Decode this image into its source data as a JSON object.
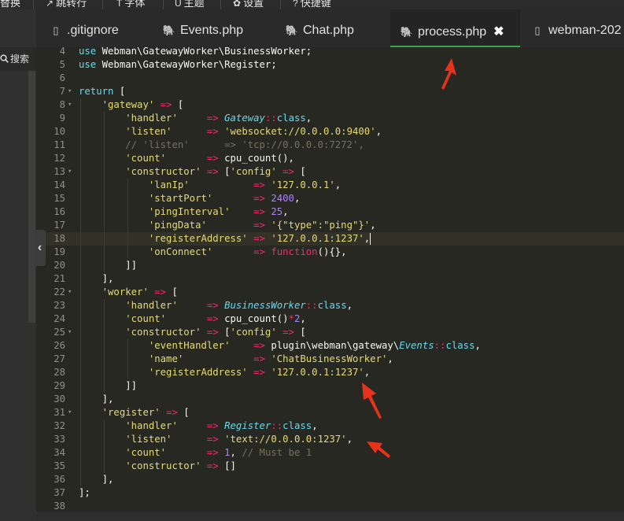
{
  "menubar": {
    "items": [
      {
        "icon": "",
        "label": "替换"
      },
      {
        "icon": "↗",
        "label": "跳转行"
      },
      {
        "icon": "T",
        "label": "字体"
      },
      {
        "icon": "U",
        "label": "主题"
      },
      {
        "icon": "✿",
        "label": "设置"
      },
      {
        "icon": "?",
        "label": "快捷键"
      }
    ]
  },
  "sidebar": {
    "search_label": "搜索",
    "search_icon": "magnifier-icon",
    "collapse_glyph": "‹"
  },
  "tabs": [
    {
      "label": ".gitignore",
      "icon": "file-icon",
      "glyph": "▯"
    },
    {
      "label": "Events.php",
      "icon": "php-elephant-icon",
      "glyph": "🐘"
    },
    {
      "label": "Chat.php",
      "icon": "php-elephant-icon",
      "glyph": "🐘"
    },
    {
      "label": "process.php",
      "icon": "php-elephant-icon",
      "glyph": "🐘",
      "active": true,
      "close": "✖"
    },
    {
      "label": "webman-202",
      "icon": "file-icon",
      "glyph": "▯"
    }
  ],
  "editor": {
    "current_line": 18,
    "lines": [
      {
        "n": "4",
        "fold": "",
        "tokens": [
          [
            "kw",
            "use"
          ],
          [
            "pl",
            " Webman\\GatewayWorker\\BusinessWorker;"
          ]
        ]
      },
      {
        "n": "5",
        "fold": "",
        "tokens": [
          [
            "kw",
            "use"
          ],
          [
            "pl",
            " Webman\\GatewayWorker\\Register;"
          ]
        ]
      },
      {
        "n": "6",
        "fold": "",
        "tokens": []
      },
      {
        "n": "7",
        "fold": "▾",
        "tokens": [
          [
            "kw",
            "return"
          ],
          [
            "pl",
            " ["
          ]
        ]
      },
      {
        "n": "8",
        "fold": "▾",
        "tokens": [
          [
            "pl",
            "    "
          ],
          [
            "str",
            "'gateway'"
          ],
          [
            "pl",
            " "
          ],
          [
            "op",
            "=>"
          ],
          [
            "pl",
            " ["
          ]
        ]
      },
      {
        "n": "9",
        "fold": "",
        "tokens": [
          [
            "pl",
            "        "
          ],
          [
            "str",
            "'handler'"
          ],
          [
            "pl",
            "     "
          ],
          [
            "op",
            "=>"
          ],
          [
            "pl",
            " "
          ],
          [
            "cls",
            "Gateway"
          ],
          [
            "op",
            "::"
          ],
          [
            "kw",
            "class"
          ],
          [
            "pl",
            ","
          ]
        ]
      },
      {
        "n": "10",
        "fold": "",
        "tokens": [
          [
            "pl",
            "        "
          ],
          [
            "str",
            "'listen'"
          ],
          [
            "pl",
            "      "
          ],
          [
            "op",
            "=>"
          ],
          [
            "pl",
            " "
          ],
          [
            "str",
            "'websocket://0.0.0.0:9400'"
          ],
          [
            "pl",
            ","
          ]
        ]
      },
      {
        "n": "11",
        "fold": "",
        "tokens": [
          [
            "pl",
            "        "
          ],
          [
            "cm",
            "// 'listen'      => 'tcp://0.0.0.0:7272',"
          ]
        ]
      },
      {
        "n": "12",
        "fold": "",
        "tokens": [
          [
            "pl",
            "        "
          ],
          [
            "str",
            "'count'"
          ],
          [
            "pl",
            "       "
          ],
          [
            "op",
            "=>"
          ],
          [
            "pl",
            " cpu_count(),"
          ]
        ]
      },
      {
        "n": "13",
        "fold": "▾",
        "tokens": [
          [
            "pl",
            "        "
          ],
          [
            "str",
            "'constructor'"
          ],
          [
            "pl",
            " "
          ],
          [
            "op",
            "=>"
          ],
          [
            "pl",
            " ["
          ],
          [
            "str",
            "'config'"
          ],
          [
            "pl",
            " "
          ],
          [
            "op",
            "=>"
          ],
          [
            "pl",
            " ["
          ]
        ]
      },
      {
        "n": "14",
        "fold": "",
        "tokens": [
          [
            "pl",
            "            "
          ],
          [
            "str",
            "'lanIp'"
          ],
          [
            "pl",
            "           "
          ],
          [
            "op",
            "=>"
          ],
          [
            "pl",
            " "
          ],
          [
            "str",
            "'127.0.0.1'"
          ],
          [
            "pl",
            ","
          ]
        ]
      },
      {
        "n": "15",
        "fold": "",
        "tokens": [
          [
            "pl",
            "            "
          ],
          [
            "str",
            "'startPort'"
          ],
          [
            "pl",
            "       "
          ],
          [
            "op",
            "=>"
          ],
          [
            "pl",
            " "
          ],
          [
            "num",
            "2400"
          ],
          [
            "pl",
            ","
          ]
        ]
      },
      {
        "n": "16",
        "fold": "",
        "tokens": [
          [
            "pl",
            "            "
          ],
          [
            "str",
            "'pingInterval'"
          ],
          [
            "pl",
            "    "
          ],
          [
            "op",
            "=>"
          ],
          [
            "pl",
            " "
          ],
          [
            "num",
            "25"
          ],
          [
            "pl",
            ","
          ]
        ]
      },
      {
        "n": "17",
        "fold": "",
        "tokens": [
          [
            "pl",
            "            "
          ],
          [
            "str",
            "'pingData'"
          ],
          [
            "pl",
            "        "
          ],
          [
            "op",
            "=>"
          ],
          [
            "pl",
            " "
          ],
          [
            "str",
            "'{\"type\":\"ping\"}'"
          ],
          [
            "pl",
            ","
          ]
        ]
      },
      {
        "n": "18",
        "fold": "",
        "tokens": [
          [
            "pl",
            "            "
          ],
          [
            "str",
            "'registerAddress'"
          ],
          [
            "pl",
            " "
          ],
          [
            "op",
            "=>"
          ],
          [
            "pl",
            " "
          ],
          [
            "str",
            "'127.0.0.1:1237'"
          ],
          [
            "pl",
            ","
          ],
          [
            "caret",
            ""
          ]
        ]
      },
      {
        "n": "19",
        "fold": "",
        "tokens": [
          [
            "pl",
            "            "
          ],
          [
            "str",
            "'onConnect'"
          ],
          [
            "pl",
            "       "
          ],
          [
            "op",
            "=>"
          ],
          [
            "pl",
            " "
          ],
          [
            "op",
            "function"
          ],
          [
            "pl",
            "(){},"
          ]
        ]
      },
      {
        "n": "20",
        "fold": "",
        "tokens": [
          [
            "pl",
            "        ]]"
          ]
        ]
      },
      {
        "n": "21",
        "fold": "",
        "tokens": [
          [
            "pl",
            "    ],"
          ]
        ]
      },
      {
        "n": "22",
        "fold": "▾",
        "tokens": [
          [
            "pl",
            "    "
          ],
          [
            "str",
            "'worker'"
          ],
          [
            "pl",
            " "
          ],
          [
            "op",
            "=>"
          ],
          [
            "pl",
            " ["
          ]
        ]
      },
      {
        "n": "23",
        "fold": "",
        "tokens": [
          [
            "pl",
            "        "
          ],
          [
            "str",
            "'handler'"
          ],
          [
            "pl",
            "     "
          ],
          [
            "op",
            "=>"
          ],
          [
            "pl",
            " "
          ],
          [
            "cls",
            "BusinessWorker"
          ],
          [
            "op",
            "::"
          ],
          [
            "kw",
            "class"
          ],
          [
            "pl",
            ","
          ]
        ]
      },
      {
        "n": "24",
        "fold": "",
        "tokens": [
          [
            "pl",
            "        "
          ],
          [
            "str",
            "'count'"
          ],
          [
            "pl",
            "       "
          ],
          [
            "op",
            "=>"
          ],
          [
            "pl",
            " cpu_count()"
          ],
          [
            "op",
            "*"
          ],
          [
            "num",
            "2"
          ],
          [
            "pl",
            ","
          ]
        ]
      },
      {
        "n": "25",
        "fold": "▾",
        "tokens": [
          [
            "pl",
            "        "
          ],
          [
            "str",
            "'constructor'"
          ],
          [
            "pl",
            " "
          ],
          [
            "op",
            "=>"
          ],
          [
            "pl",
            " ["
          ],
          [
            "str",
            "'config'"
          ],
          [
            "pl",
            " "
          ],
          [
            "op",
            "=>"
          ],
          [
            "pl",
            " ["
          ]
        ]
      },
      {
        "n": "26",
        "fold": "",
        "tokens": [
          [
            "pl",
            "            "
          ],
          [
            "str",
            "'eventHandler'"
          ],
          [
            "pl",
            "    "
          ],
          [
            "op",
            "=>"
          ],
          [
            "pl",
            " plugin\\webman\\gateway\\"
          ],
          [
            "cls",
            "Events"
          ],
          [
            "op",
            "::"
          ],
          [
            "kw",
            "class"
          ],
          [
            "pl",
            ","
          ]
        ]
      },
      {
        "n": "27",
        "fold": "",
        "tokens": [
          [
            "pl",
            "            "
          ],
          [
            "str",
            "'name'"
          ],
          [
            "pl",
            "            "
          ],
          [
            "op",
            "=>"
          ],
          [
            "pl",
            " "
          ],
          [
            "str",
            "'ChatBusinessWorker'"
          ],
          [
            "pl",
            ","
          ]
        ]
      },
      {
        "n": "28",
        "fold": "",
        "tokens": [
          [
            "pl",
            "            "
          ],
          [
            "str",
            "'registerAddress'"
          ],
          [
            "pl",
            " "
          ],
          [
            "op",
            "=>"
          ],
          [
            "pl",
            " "
          ],
          [
            "str",
            "'127.0.0.1:1237'"
          ],
          [
            "pl",
            ","
          ]
        ]
      },
      {
        "n": "29",
        "fold": "",
        "tokens": [
          [
            "pl",
            "        ]]"
          ]
        ]
      },
      {
        "n": "30",
        "fold": "",
        "tokens": [
          [
            "pl",
            "    ],"
          ]
        ]
      },
      {
        "n": "31",
        "fold": "▾",
        "tokens": [
          [
            "pl",
            "    "
          ],
          [
            "str",
            "'register'"
          ],
          [
            "pl",
            " "
          ],
          [
            "op",
            "=>"
          ],
          [
            "pl",
            " ["
          ]
        ]
      },
      {
        "n": "32",
        "fold": "",
        "tokens": [
          [
            "pl",
            "        "
          ],
          [
            "str",
            "'handler'"
          ],
          [
            "pl",
            "     "
          ],
          [
            "op",
            "=>"
          ],
          [
            "pl",
            " "
          ],
          [
            "cls",
            "Register"
          ],
          [
            "op",
            "::"
          ],
          [
            "kw",
            "class"
          ],
          [
            "pl",
            ","
          ]
        ]
      },
      {
        "n": "33",
        "fold": "",
        "tokens": [
          [
            "pl",
            "        "
          ],
          [
            "str",
            "'listen'"
          ],
          [
            "pl",
            "      "
          ],
          [
            "op",
            "=>"
          ],
          [
            "pl",
            " "
          ],
          [
            "str",
            "'text://0.0.0.0:1237'"
          ],
          [
            "pl",
            ","
          ]
        ]
      },
      {
        "n": "34",
        "fold": "",
        "tokens": [
          [
            "pl",
            "        "
          ],
          [
            "str",
            "'count'"
          ],
          [
            "pl",
            "       "
          ],
          [
            "op",
            "=>"
          ],
          [
            "pl",
            " "
          ],
          [
            "num",
            "1"
          ],
          [
            "pl",
            ", "
          ],
          [
            "cm",
            "// Must be 1"
          ]
        ]
      },
      {
        "n": "35",
        "fold": "",
        "tokens": [
          [
            "pl",
            "        "
          ],
          [
            "str",
            "'constructor'"
          ],
          [
            "pl",
            " "
          ],
          [
            "op",
            "=>"
          ],
          [
            "pl",
            " []"
          ]
        ]
      },
      {
        "n": "36",
        "fold": "",
        "tokens": [
          [
            "pl",
            "    ],"
          ]
        ]
      },
      {
        "n": "37",
        "fold": "",
        "tokens": [
          [
            "pl",
            "];"
          ]
        ]
      },
      {
        "n": "38",
        "fold": "",
        "tokens": []
      }
    ]
  },
  "colors": {
    "editor_bg": "#272822",
    "annotation_arrow": "#e8321c",
    "active_tab_underline": "#3fa34d",
    "keyword": "#66d9ef",
    "string": "#e6db74",
    "operator": "#f92672",
    "number": "#ae81ff",
    "comment": "#75715e"
  },
  "annotations": [
    {
      "name": "annotation-arrow-tab"
    },
    {
      "name": "annotation-arrow-register-address"
    },
    {
      "name": "annotation-arrow-register-listen"
    }
  ]
}
